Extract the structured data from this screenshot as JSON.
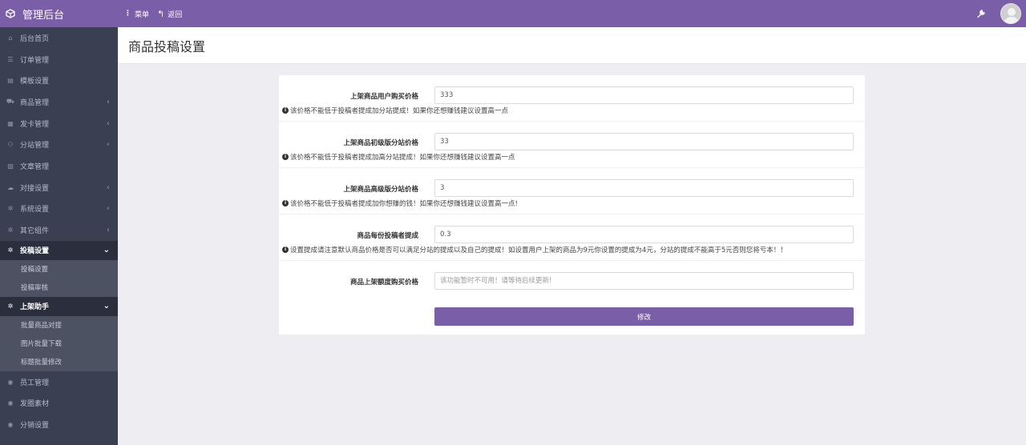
{
  "app": {
    "title": "管理后台"
  },
  "topbar": {
    "menu_label": "菜单",
    "back_label": "返回"
  },
  "sidebar": {
    "items": [
      {
        "label": "后台首页",
        "icon": "home-icon",
        "glyph": "⌂"
      },
      {
        "label": "订单管理",
        "icon": "list-icon",
        "glyph": "☰"
      },
      {
        "label": "模板设置",
        "icon": "template-icon",
        "glyph": "▤"
      },
      {
        "label": "商品管理",
        "icon": "cart-icon",
        "glyph": "⛟",
        "caret": "‹"
      },
      {
        "label": "发卡管理",
        "icon": "grid-icon",
        "glyph": "▦",
        "caret": "‹"
      },
      {
        "label": "分站管理",
        "icon": "sitemap-icon",
        "glyph": "⚇",
        "caret": "‹"
      },
      {
        "label": "文章管理",
        "icon": "article-icon",
        "glyph": "▧"
      },
      {
        "label": "对接设置",
        "icon": "cloud-icon",
        "glyph": "☁",
        "caret": "‹"
      },
      {
        "label": "系统设置",
        "icon": "gear-icon",
        "glyph": "✲",
        "caret": "‹"
      },
      {
        "label": "其它组件",
        "icon": "cogs-icon",
        "glyph": "✲",
        "caret": "‹"
      }
    ],
    "group1": {
      "label": "投稿设置",
      "icon": "cogs-icon",
      "caret": "⌄",
      "children": [
        "投稿设置",
        "投稿审核"
      ]
    },
    "group2": {
      "label": "上架助手",
      "icon": "cogs-icon",
      "caret": "⌄",
      "children": [
        "批量商品对接",
        "图片批量下载",
        "标题批量修改"
      ]
    },
    "bottom": [
      {
        "label": "员工管理",
        "icon": "user-icon",
        "glyph": "◉"
      },
      {
        "label": "发圈素材",
        "icon": "user-icon",
        "glyph": "◉"
      },
      {
        "label": "分销设置",
        "icon": "user-icon",
        "glyph": "◉"
      }
    ]
  },
  "page": {
    "title": "商品投稿设置"
  },
  "form": {
    "rows": [
      {
        "label": "上架商品用户购买价格",
        "value": "333",
        "help": "该价格不能低于投稿者提成加分站提成！如果你还想赚钱建议设置高一点"
      },
      {
        "label": "上架商品初级版分站价格",
        "value": "33",
        "help": "该价格不能低于投稿者提成加高分站提成！如果你还想赚钱建议设置高一点"
      },
      {
        "label": "上架商品高级版分站价格",
        "value": "3",
        "help": "该价格不能低于投稿者提成加你想赚的钱！如果你还想赚钱建议设置高一点!"
      },
      {
        "label": "商品每份投稿者提成",
        "value": "0.3",
        "help": "设置提成请注意默认商品价格是否可以满足分站的提成以及自己的提成！如设置用户上架的商品为9元你设置的提成为4元，分站的提成不能高于5元否则您将亏本！！"
      }
    ],
    "disabled_row": {
      "label": "商品上架额度购买价格",
      "placeholder": "该功能暂时不可用！请等待后续更新!"
    },
    "submit_label": "修改"
  },
  "colors": {
    "accent": "#7b5ea8",
    "sidebar": "#3a3f51"
  }
}
